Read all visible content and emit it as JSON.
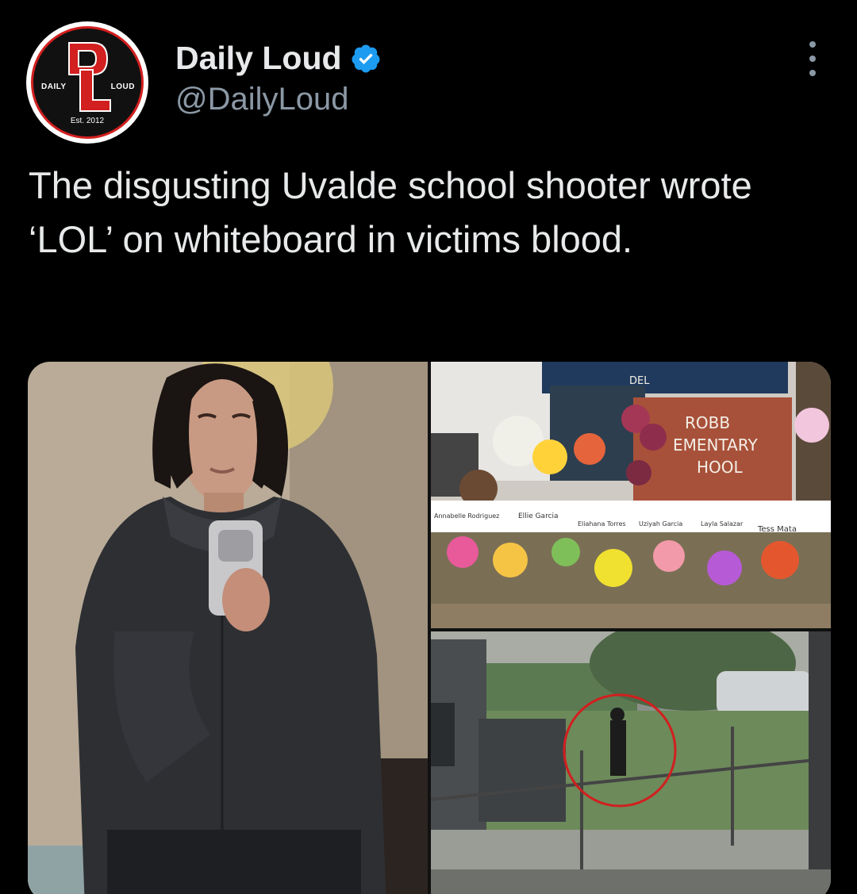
{
  "tweet": {
    "author": {
      "display_name": "Daily Loud",
      "handle": "@DailyLoud",
      "verified": true,
      "avatar": {
        "logo_left": "DAILY",
        "logo_right": "LOUD",
        "logo_bottom": "Est. 2012"
      }
    },
    "text": "The disgusting Uvalde school shooter wrote ‘LOL’ on whiteboard in victims blood.",
    "media": {
      "memorial_sign_lines": [
        "ROBB",
        "EMENTARY",
        "HOOL"
      ],
      "memorial_banner": "DEL",
      "cross_names": [
        "Annabelle Rodriguez",
        "Ellie Garcia",
        "Eliahana Torres",
        "Uziyah Garcia",
        "Layla Salazar",
        "Tess Mata"
      ]
    }
  },
  "colors": {
    "background": "#000000",
    "text_primary": "#e7e9ea",
    "text_secondary": "#8b98a5",
    "verified_blue": "#1d9bf0",
    "logo_red": "#d21f1f"
  },
  "icons": {
    "verified": "verified-badge-icon",
    "more": "more-options-icon"
  }
}
